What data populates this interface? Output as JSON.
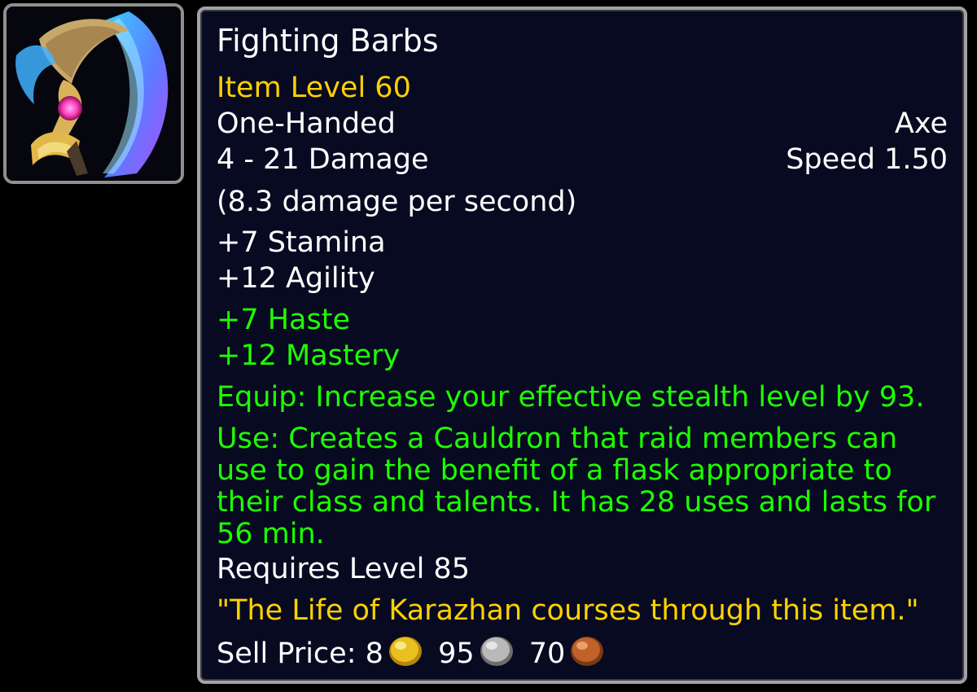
{
  "item": {
    "icon": "one-handed-axe-icon",
    "name": "Fighting Barbs",
    "item_level": "Item Level 60",
    "slot": "One-Handed",
    "type": "Axe",
    "damage": "4 - 21 Damage",
    "speed": "Speed 1.50",
    "dps": "(8.3 damage per second)",
    "stats": [
      "+7 Stamina",
      "+12 Agility"
    ],
    "bonus_stats": [
      "+7 Haste",
      "+12 Mastery"
    ],
    "equip": "Equip: Increase your effective stealth level by 93.",
    "use": "Use: Creates a Cauldron that raid members can use to gain the benefit of a flask appropriate to their class and talents. It has 28 uses and lasts for 56 min.",
    "requires": "Requires Level 85",
    "flavor": "\"The Life of Karazhan courses through this item.\"",
    "sell_price": {
      "label": "Sell Price:",
      "gold": "8",
      "silver": "95",
      "copper": "70",
      "icons": [
        "gold-coin-icon",
        "silver-coin-icon",
        "copper-coin-icon"
      ]
    }
  },
  "colors": {
    "white": "#ffffff",
    "item_level": "#ffd100",
    "green_stat": "#1eff00",
    "flavor": "#ffd100",
    "background": "#070a21"
  }
}
